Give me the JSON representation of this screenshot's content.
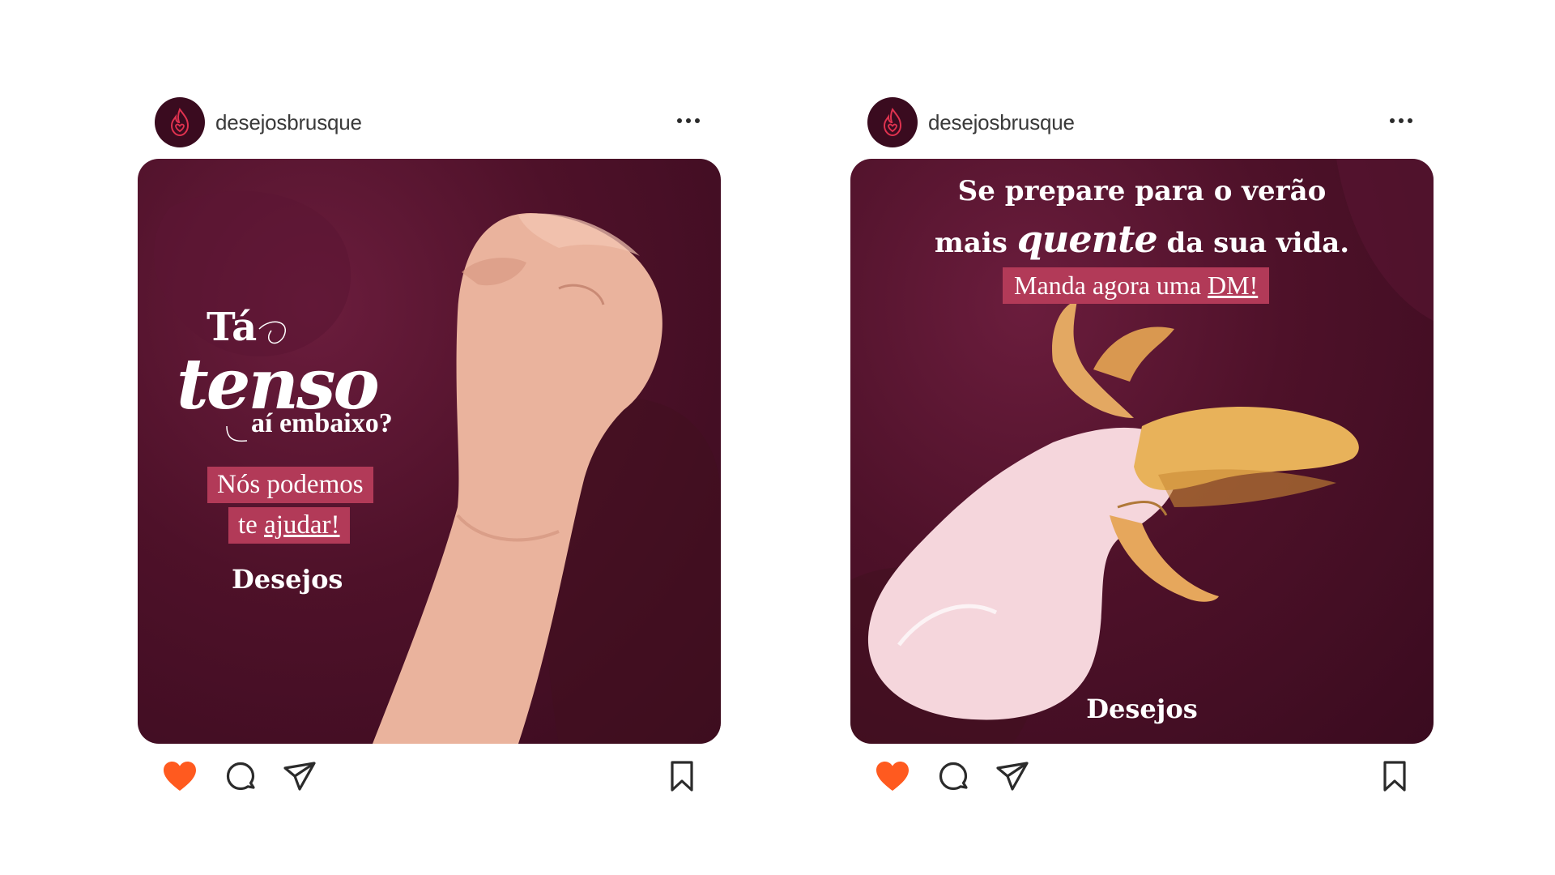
{
  "posts": [
    {
      "username": "desejosbrusque",
      "image": {
        "line_ta": "Tá",
        "line_tenso": "tenso",
        "line_embaixo": "aí embaixo?",
        "pill_line1": "Nós podemos",
        "pill_line2_pre": "te ",
        "pill_line2_ul": "ajudar!",
        "brand": "Desejos"
      },
      "actions": [
        "heart-icon",
        "comment-icon",
        "share-icon",
        "bookmark-icon"
      ]
    },
    {
      "username": "desejosbrusque",
      "image": {
        "headline_line1": "Se prepare para o verão",
        "headline_line2_pre": "mais ",
        "headline_line2_em": "quente",
        "headline_line2_post": " da sua vida.",
        "pill_pre": "Manda agora uma ",
        "pill_ul": "DM!",
        "brand": "Desejos"
      },
      "actions": [
        "heart-icon",
        "comment-icon",
        "share-icon",
        "bookmark-icon"
      ]
    }
  ],
  "colors": {
    "background": "#ffffff",
    "card": "#4e1129",
    "card_dark": "#3a0b1f",
    "pill": "#b23a58",
    "like": "#ff5a1f",
    "icon": "#2b2b2b",
    "logo_accent": "#e0324f"
  }
}
